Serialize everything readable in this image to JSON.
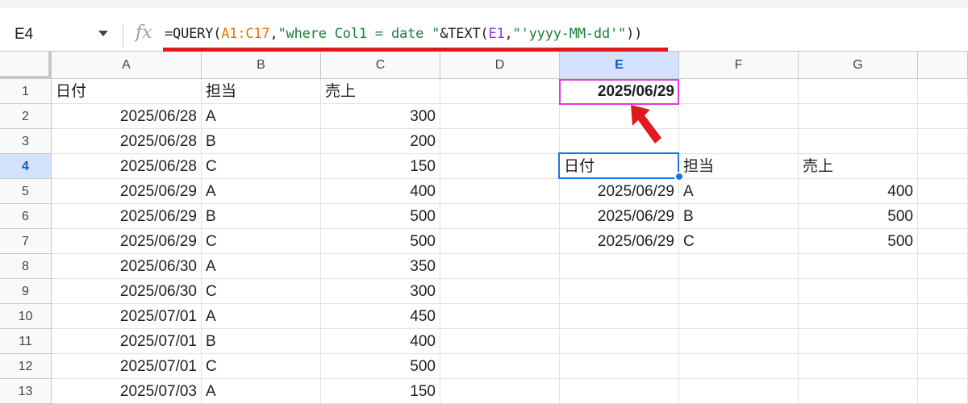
{
  "name_box": "E4",
  "formula_bar": {
    "fx_icon": "fx-icon",
    "formula_parts": {
      "prefix": "=QUERY(",
      "range": "A1:C17",
      "middle": ",",
      "string1": "\"where Col1 = date \"",
      "concat": "&TEXT(",
      "ref": "E1",
      "comma": ",",
      "string2": "\"'yyyy-MM-dd'\"",
      "suffix": "))"
    }
  },
  "columns": [
    "A",
    "B",
    "C",
    "D",
    "E",
    "F",
    "G"
  ],
  "selected_column": "E",
  "rows": [
    "1",
    "2",
    "3",
    "4",
    "5",
    "6",
    "7",
    "8",
    "9",
    "10",
    "11",
    "12",
    "13"
  ],
  "selected_row": "4",
  "table": {
    "headers": [
      "日付",
      "担当",
      "売上"
    ],
    "records": [
      [
        "2025/06/28",
        "A",
        "300"
      ],
      [
        "2025/06/28",
        "B",
        "200"
      ],
      [
        "2025/06/28",
        "C",
        "150"
      ],
      [
        "2025/06/29",
        "A",
        "400"
      ],
      [
        "2025/06/29",
        "B",
        "500"
      ],
      [
        "2025/06/29",
        "C",
        "500"
      ],
      [
        "2025/06/30",
        "A",
        "350"
      ],
      [
        "2025/06/30",
        "C",
        "300"
      ],
      [
        "2025/07/01",
        "A",
        "450"
      ],
      [
        "2025/07/01",
        "B",
        "400"
      ],
      [
        "2025/07/01",
        "C",
        "500"
      ],
      [
        "2025/07/03",
        "A",
        "150"
      ]
    ]
  },
  "e1_value": "2025/06/29",
  "query_result": {
    "headers": [
      "日付",
      "担当",
      "売上"
    ],
    "records": [
      [
        "2025/06/29",
        "A",
        "400"
      ],
      [
        "2025/06/29",
        "B",
        "500"
      ],
      [
        "2025/06/29",
        "C",
        "500"
      ]
    ]
  },
  "colors": {
    "selection_blue": "#1a73e8",
    "highlight_magenta": "#e03ad7",
    "annotation_red": "#e0191e",
    "range_orange": "#e37400",
    "string_green": "#188038",
    "ref_purple": "#9334e6"
  }
}
